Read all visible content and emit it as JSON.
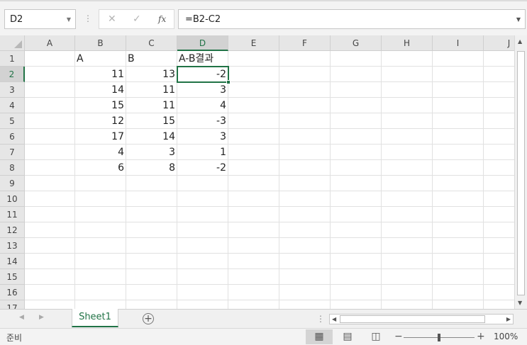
{
  "name_box": {
    "value": "D2"
  },
  "formula_bar": {
    "value": "=B2-C2",
    "cancel_icon": "close-icon",
    "enter_icon": "check-icon",
    "function_label": "fx"
  },
  "columns": [
    "A",
    "B",
    "C",
    "D",
    "E",
    "F",
    "G",
    "H",
    "I",
    "J"
  ],
  "selected_column": "D",
  "rows": [
    "1",
    "2",
    "3",
    "4",
    "5",
    "6",
    "7",
    "8",
    "9",
    "10",
    "11",
    "12",
    "13",
    "14",
    "15",
    "16",
    "17"
  ],
  "selected_row": "2",
  "cells": {
    "B1": "A",
    "C1": "B",
    "D1": "A-B결과",
    "B2": "11",
    "C2": "13",
    "D2": "-2",
    "B3": "14",
    "C3": "11",
    "D3": "3",
    "B4": "15",
    "C4": "11",
    "D4": "4",
    "B5": "12",
    "C5": "15",
    "D5": "-3",
    "B6": "17",
    "C6": "14",
    "D6": "3",
    "B7": "4",
    "C7": "3",
    "D7": "1",
    "B8": "6",
    "C8": "8",
    "D8": "-2"
  },
  "active_cell": "D2",
  "sheet_tabs": [
    {
      "label": "Sheet1",
      "active": true
    }
  ],
  "status_bar": {
    "ready_text": "준비",
    "zoom_level": "100%",
    "zoom_fraction": 0.5
  },
  "colors": {
    "accent": "#217346",
    "header_bg": "#e6e6e6",
    "gridline": "#e1e1e1"
  }
}
